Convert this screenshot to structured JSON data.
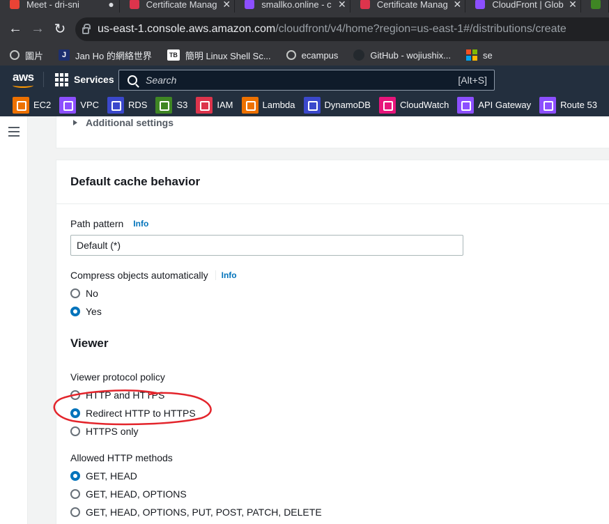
{
  "browser": {
    "tabs": [
      {
        "label": "Meet - dri-sni",
        "color": "#ea4335"
      },
      {
        "label": "Certificate Manag",
        "color": "#dd344c"
      },
      {
        "label": "smallko.online - c",
        "color": "#8c4fff"
      },
      {
        "label": "Certificate Manag",
        "color": "#dd344c"
      },
      {
        "label": "CloudFront | Glob",
        "color": "#8c4fff"
      }
    ],
    "url_host": "us-east-1.console.aws.amazon.com",
    "url_path": "/cloudfront/v4/home?region=us-east-1#/distributions/create",
    "bookmarks": [
      {
        "label": "圖片",
        "icon": "globe-icon"
      },
      {
        "label": "Jan Ho 的網絡世界",
        "icon": "J",
        "icon_text": "J"
      },
      {
        "label": "簡明 Linux Shell Sc...",
        "icon": "TB",
        "icon_text": "TB"
      },
      {
        "label": "ecampus",
        "icon": "globe-icon"
      },
      {
        "label": "GitHub - wojiushix...",
        "icon": "github-icon"
      },
      {
        "label": "se",
        "icon": "microsoft-icon"
      }
    ]
  },
  "aws": {
    "logo": "aws",
    "services_label": "Services",
    "search_placeholder": "Search",
    "search_hotkey": "[Alt+S]",
    "shortcuts": [
      {
        "label": "EC2",
        "color": "#ed7100"
      },
      {
        "label": "VPC",
        "color": "#8c4fff"
      },
      {
        "label": "RDS",
        "color": "#3b48cc"
      },
      {
        "label": "S3",
        "color": "#3f8624"
      },
      {
        "label": "IAM",
        "color": "#dd344c"
      },
      {
        "label": "Lambda",
        "color": "#ed7100"
      },
      {
        "label": "DynamoDB",
        "color": "#3b48cc"
      },
      {
        "label": "CloudWatch",
        "color": "#e7157b"
      },
      {
        "label": "API Gateway",
        "color": "#8c4fff"
      },
      {
        "label": "Route 53",
        "color": "#8c4fff"
      }
    ]
  },
  "content": {
    "additional_settings": "Additional settings",
    "section_title": "Default cache behavior",
    "path_pattern": {
      "label": "Path pattern",
      "info": "Info",
      "value": "Default (*)"
    },
    "compress": {
      "label": "Compress objects automatically",
      "info": "Info",
      "options": [
        {
          "label": "No",
          "checked": false
        },
        {
          "label": "Yes",
          "checked": true
        }
      ]
    },
    "viewer_heading": "Viewer",
    "viewer_protocol": {
      "label": "Viewer protocol policy",
      "options": [
        {
          "label": "HTTP and HTTPS",
          "checked": false
        },
        {
          "label": "Redirect HTTP to HTTPS",
          "checked": true
        },
        {
          "label": "HTTPS only",
          "checked": false
        }
      ]
    },
    "allowed_methods": {
      "label": "Allowed HTTP methods",
      "options": [
        {
          "label": "GET, HEAD",
          "checked": true
        },
        {
          "label": "GET, HEAD, OPTIONS",
          "checked": false
        },
        {
          "label": "GET, HEAD, OPTIONS, PUT, POST, PATCH, DELETE",
          "checked": false
        }
      ]
    }
  },
  "colors": {
    "aws_nav": "#232f3e",
    "accent": "#0073bb",
    "annotation": "#e3242b"
  }
}
